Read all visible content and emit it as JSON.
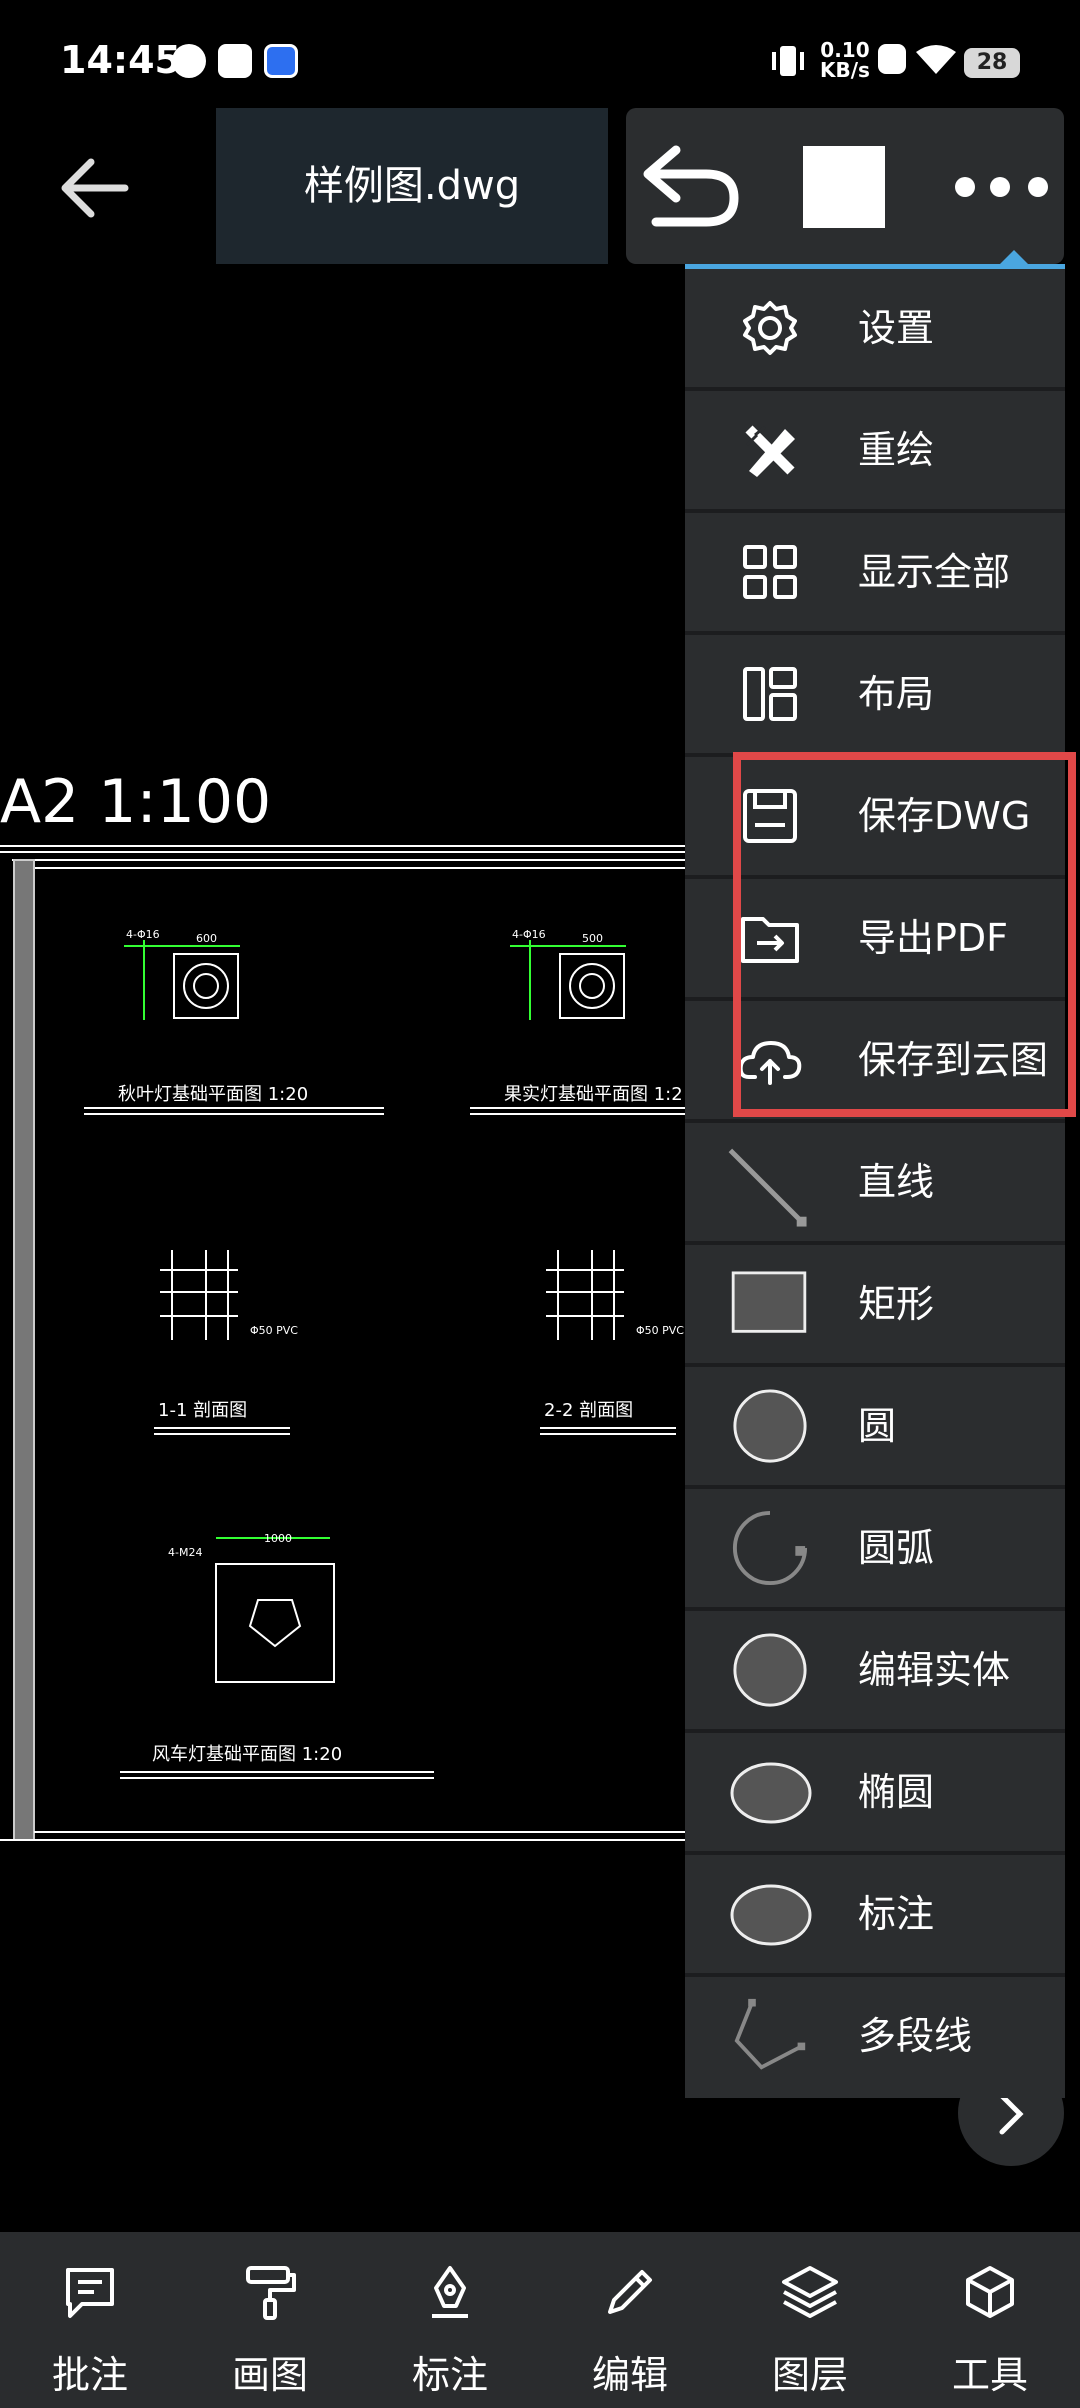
{
  "status_bar": {
    "time": "14:45",
    "net_speed_value": "0.10",
    "net_speed_unit": "KB/s",
    "battery": "28"
  },
  "header": {
    "file_title": "样例图.dwg"
  },
  "drawing": {
    "sheet_label": "A2 1:100",
    "title_1": "秋叶灯基础平面图  1:20",
    "title_2": "果实灯基础平面图  1:2",
    "title_3": "1-1 剖面图",
    "title_4": "2-2 剖面图",
    "title_5": "风车灯基础平面图  1:20",
    "dim_600": "600",
    "dim_500": "500",
    "dim_1000": "1000",
    "note_1": "4-Φ16",
    "note_2": "4-Φ16",
    "note_3": "4-M24",
    "pvc_1": "Φ50 PVC",
    "pvc_2": "Φ50 PVC"
  },
  "menu": {
    "items": [
      {
        "label": "设置",
        "icon": "gear-icon"
      },
      {
        "label": "重绘",
        "icon": "pencil-ruler-icon"
      },
      {
        "label": "显示全部",
        "icon": "grid-icon"
      },
      {
        "label": "布局",
        "icon": "layout-icon"
      },
      {
        "label": "保存DWG",
        "icon": "save-icon"
      },
      {
        "label": "导出PDF",
        "icon": "export-folder-icon"
      },
      {
        "label": "保存到云图",
        "icon": "cloud-upload-icon"
      },
      {
        "label": "直线",
        "icon": "line-icon"
      },
      {
        "label": "矩形",
        "icon": "rectangle-icon"
      },
      {
        "label": "圆",
        "icon": "circle-icon"
      },
      {
        "label": "圆弧",
        "icon": "arc-icon"
      },
      {
        "label": "编辑实体",
        "icon": "entity-circle-icon"
      },
      {
        "label": "椭圆",
        "icon": "ellipse-icon"
      },
      {
        "label": "标注",
        "icon": "dimension-ellipse-icon"
      },
      {
        "label": "多段线",
        "icon": "polyline-icon"
      }
    ]
  },
  "bottom_bar": {
    "items": [
      {
        "label": "批注",
        "icon": "comment-icon"
      },
      {
        "label": "画图",
        "icon": "paint-roller-icon"
      },
      {
        "label": "标注",
        "icon": "pen-nib-icon"
      },
      {
        "label": "编辑",
        "icon": "pencil-icon"
      },
      {
        "label": "图层",
        "icon": "layers-icon"
      },
      {
        "label": "工具",
        "icon": "cube-icon"
      }
    ]
  },
  "colors": {
    "accent": "#4aa6e0",
    "highlight": "#e04848",
    "panel": "#2b2d2f",
    "cad_green": "#33ff33"
  }
}
